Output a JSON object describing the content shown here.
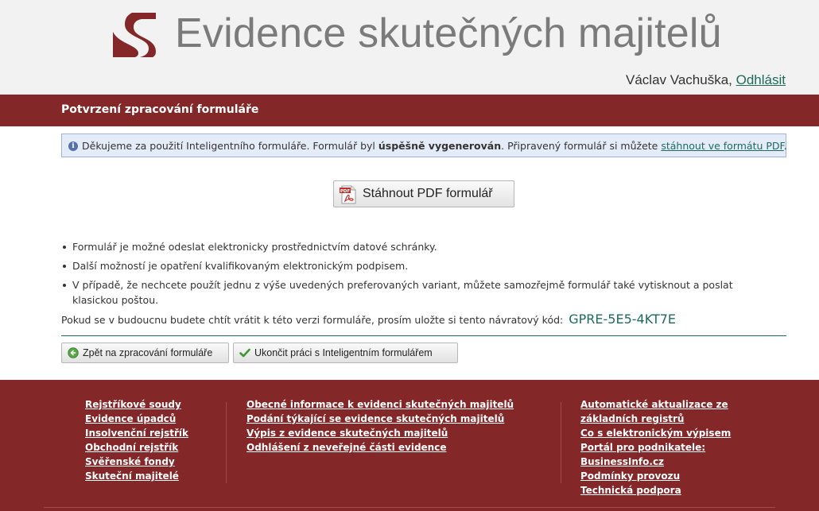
{
  "header": {
    "title": "Evidence skutečných majitelů",
    "user_name": "Václav Vachuška,",
    "logout_label": "Odhlásit"
  },
  "page": {
    "title": "Potvrzení zpracování formuláře"
  },
  "info": {
    "text_1": "Děkujeme za použití Inteligentního formuláře. Formulář byl",
    "bold": "úspěšně vygenerován",
    "text_2": ". Připravený formulář si můžete",
    "link": "stáhnout ve formátu PDF",
    "text_3": "."
  },
  "pdf_button": {
    "label": "Stáhnout PDF formulář",
    "icon": "pdf-icon",
    "icon_text": "PDF"
  },
  "bullets": [
    "Formulář je možné odeslat elektronicky prostřednictvím datové schránky.",
    "Další možností je opatření kvalifikovaným elektronickým podpisem.",
    "V případě, že nechcete použít jednu z výše uvedených preferovaných variant, můžete samozřejmě formulář také vytisknout a poslat klasickou poštou."
  ],
  "return_code": {
    "text": "Pokud se v budoucnu budete chtít vrátit k této verzi formuláře, prosím uložte si tento návratový kód:",
    "code": "GPRE-5E5-4KT7E"
  },
  "buttons": {
    "back_label": "Zpět na zpracování formuláře",
    "finish_label": "Ukončit práci s Inteligentním formulářem"
  },
  "footer": {
    "col1": [
      "Rejstříkové soudy",
      "Evidence úpadců",
      "Insolvenční rejstřík",
      "Obchodní rejstřík",
      "Svěřenské fondy",
      "Skuteční majitelé"
    ],
    "col2": [
      "Obecné informace k evidenci skutečných majitelů",
      "Podání týkající se evidence skutečných majitelů",
      "Výpis z evidence skutečných majitelů",
      "Odhlášení z neveřejné části evidence"
    ],
    "col3": [
      "Automatické aktualizace ze základních registrů",
      "Co s elektronickým výpisem",
      "Portál pro podnikatele: BusinessInfo.cz",
      "Podmínky provozu",
      "Technická podpora"
    ]
  },
  "colors": {
    "brand": "#842728",
    "link": "#1e6b5a",
    "info_bg": "#e5ecf9"
  }
}
